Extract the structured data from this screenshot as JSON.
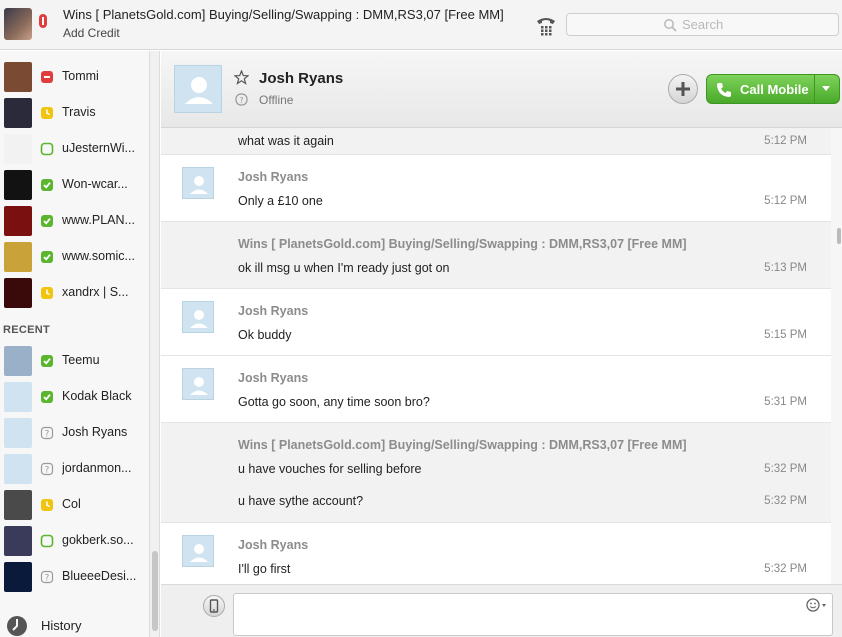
{
  "header": {
    "account_name": "Wins [ PlanetsGold.com] Buying/Selling/Swapping : DMM,RS3,07 [Free MM]",
    "add_credit": "Add Credit",
    "search_placeholder": "Search"
  },
  "sidebar": {
    "contacts": [
      {
        "name": "Tommi",
        "status": "busy",
        "avatar": "#7a4a32"
      },
      {
        "name": "Travis",
        "status": "away",
        "avatar": "#2a2a3a"
      },
      {
        "name": "uJesternWi...",
        "status": "offline-green",
        "avatar": "#f2f2f2"
      },
      {
        "name": "Won-wcar...",
        "status": "online",
        "avatar": "#121212"
      },
      {
        "name": "www.PLAN...",
        "status": "online",
        "avatar": "#7a1010"
      },
      {
        "name": "www.somic...",
        "status": "online",
        "avatar": "#c9a23a"
      },
      {
        "name": "xandrx | S...",
        "status": "away",
        "avatar": "#3a0a0a"
      }
    ],
    "recent_header": "RECENT",
    "recent": [
      {
        "name": "Teemu",
        "status": "online",
        "avatar": "#9ab0c8"
      },
      {
        "name": "Kodak Black",
        "status": "online",
        "avatar": "#cfe4f0"
      },
      {
        "name": "Josh Ryans",
        "status": "unknown",
        "avatar": "#cfe4f0"
      },
      {
        "name": "jordanmon...",
        "status": "unknown",
        "avatar": "#cfe4f0"
      },
      {
        "name": "Col",
        "status": "away",
        "avatar": "#4a4a4a"
      },
      {
        "name": "gokberk.so...",
        "status": "offline-green",
        "avatar": "#3a3a5a"
      },
      {
        "name": "BlueeeDesi...",
        "status": "unknown",
        "avatar": "#0a1a3a"
      }
    ],
    "history_label": "History"
  },
  "conversation": {
    "peer_name": "Josh Ryans",
    "peer_status": "Offline",
    "call_label": "Call Mobile"
  },
  "messages": [
    {
      "kind": "mine",
      "author": "",
      "lines": [
        {
          "text": "what was it again",
          "time": "5:12 PM"
        }
      ]
    },
    {
      "kind": "peer",
      "author": "Josh Ryans",
      "lines": [
        {
          "text": "Only a £10 one",
          "time": "5:12 PM"
        }
      ]
    },
    {
      "kind": "mine",
      "author": "Wins [ PlanetsGold.com] Buying/Selling/Swapping : DMM,RS3,07 [Free MM]",
      "lines": [
        {
          "text": "ok ill msg u when I'm ready just got on",
          "time": "5:13 PM"
        }
      ]
    },
    {
      "kind": "peer",
      "author": "Josh Ryans",
      "lines": [
        {
          "text": "Ok buddy",
          "time": "5:15 PM"
        }
      ]
    },
    {
      "kind": "peer",
      "author": "Josh Ryans",
      "lines": [
        {
          "text": "Gotta go soon, any time soon bro?",
          "time": "5:31 PM"
        }
      ]
    },
    {
      "kind": "mine",
      "author": "Wins [ PlanetsGold.com] Buying/Selling/Swapping : DMM,RS3,07 [Free MM]",
      "lines": [
        {
          "text": "u have vouches for selling before",
          "time": "5:32 PM"
        },
        {
          "text": "u have sythe account?",
          "time": "5:32 PM"
        }
      ]
    },
    {
      "kind": "peer",
      "author": "Josh Ryans",
      "lines": [
        {
          "text": "I'll go first",
          "time": "5:32 PM"
        }
      ]
    }
  ],
  "colors": {
    "online": "#5bb52f",
    "away": "#f1c40f",
    "busy": "#e23d3d",
    "accent_green": "#5fbf3a"
  }
}
